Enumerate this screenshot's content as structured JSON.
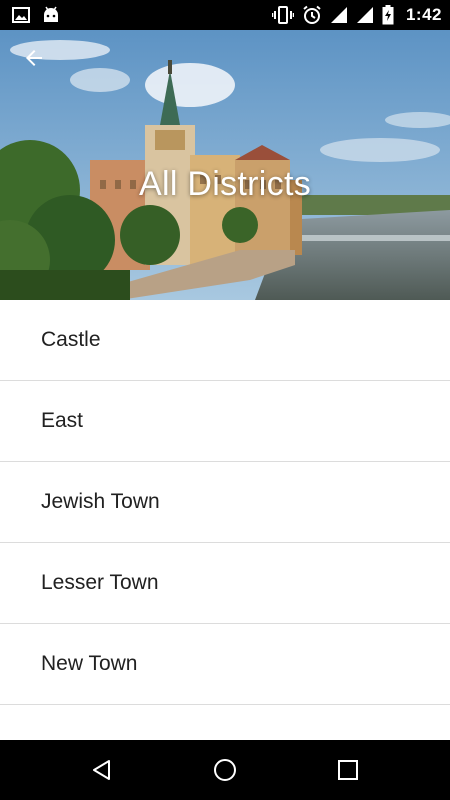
{
  "status_bar": {
    "time": "1:42",
    "left_icons": [
      "image-icon",
      "android-icon"
    ],
    "right_icons": [
      "vibrate-icon",
      "alarm-icon",
      "signal-icon",
      "signal-icon",
      "battery-charging-icon"
    ]
  },
  "header": {
    "title": "All Districts",
    "back_icon": "arrow-back-icon"
  },
  "districts": [
    {
      "label": "Castle"
    },
    {
      "label": "East"
    },
    {
      "label": "Jewish Town"
    },
    {
      "label": "Lesser Town"
    },
    {
      "label": "New Town"
    }
  ],
  "nav_bar": {
    "buttons": [
      "back-triangle-icon",
      "home-circle-icon",
      "recents-square-icon"
    ]
  },
  "colors": {
    "status_bar_bg": "#000000",
    "list_text": "#212121",
    "divider": "#dcdcdc",
    "title_text": "#ffffff"
  }
}
